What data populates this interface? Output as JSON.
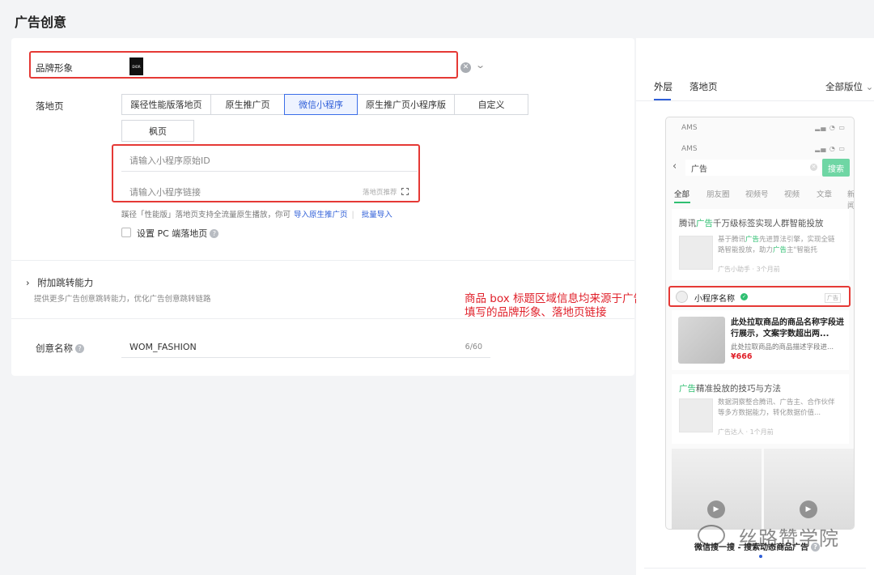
{
  "page": {
    "title": "广告创意"
  },
  "form": {
    "brand_label": "品牌形象",
    "brand_logo_text": "DIOR",
    "landing_label": "落地页",
    "landing_options": [
      "蹊径性能版落地页",
      "原生推广页",
      "微信小程序",
      "原生推广页小程序版",
      "自定义"
    ],
    "landing_selected": "微信小程序",
    "landing_option_extra": "枫页",
    "mini_id_placeholder": "请输入小程序原始ID",
    "mini_link_placeholder": "请输入小程序链接",
    "landing_recommend": "落地页推荐",
    "hint_text": "蹊径「性能版」落地页支持全流量原生播放，你可",
    "hint_link1": "导入原生推广页",
    "hint_link2": "批量导入",
    "pc_landing_label": "设置 PC 端落地页",
    "extra_jump_title": "附加跳转能力",
    "extra_jump_desc": "提供更多广告创意跳转能力，优化广告创意跳转链路",
    "creative_name_label": "创意名称",
    "creative_name_value": "WOM_FASHION",
    "creative_name_counter": "6/60"
  },
  "annotation": {
    "line1": "商品 box 标题区域信息均来源于广告主",
    "line2": "填写的品牌形象、落地页链接"
  },
  "preview": {
    "tabs": [
      "外层",
      "落地页"
    ],
    "active_tab": "外层",
    "version_select": "全部版位",
    "status_carrier": "AMS",
    "search_query": "广告",
    "search_button": "搜索",
    "result_tabs": [
      "全部",
      "朋友圈",
      "视频号",
      "视频",
      "文章",
      "新闻"
    ],
    "card1": {
      "title_pre": "腾讯",
      "title_green": "广告",
      "title_post": "千万级标签实现人群智能投放",
      "desc_a": "基于腾讯",
      "desc_green": "广告",
      "desc_b": "先进算法引擎，实现全链路智能投放，助力",
      "desc_green2": "广告",
      "desc_c": "主\"智能托",
      "meta": "广告小助手 · 3个月前"
    },
    "mini_program": {
      "name": "小程序名称",
      "ad_tag": "广告"
    },
    "goods": {
      "title": "此处拉取商品的商品名称字段进行展示，文案字数超出两...",
      "desc": "此处拉取商品的商品描述字段进...",
      "price": "¥666"
    },
    "card2": {
      "title_green": "广告",
      "title_post": "精准投放的技巧与方法",
      "desc": "数据洞察整合腾讯、广告主、合作伙伴等多方数据能力，转化数据价值...",
      "meta": "广告达人 · 1个月前"
    },
    "caption": "微信搜一搜 - 搜索动态商品广告"
  },
  "watermark": "丝路赞学院",
  "colors": {
    "accent": "#2f5fd8",
    "highlight": "#e53935",
    "green": "#2fbf71"
  }
}
